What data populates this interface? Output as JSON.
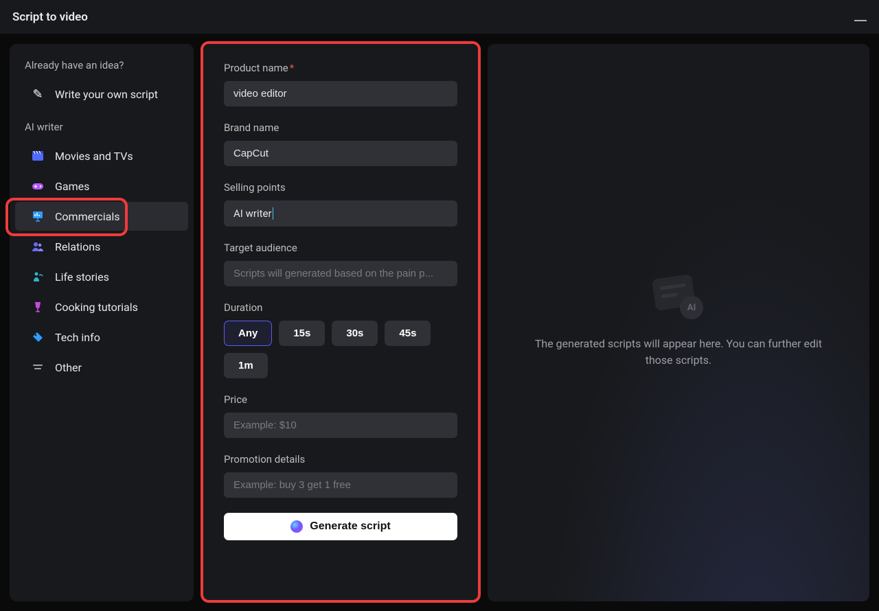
{
  "titlebar": {
    "title": "Script to video"
  },
  "sidebar": {
    "idea_label": "Already have an idea?",
    "write_own": "Write your own script",
    "ai_writer_label": "AI writer",
    "items": [
      {
        "label": "Movies and TVs",
        "name": "movies",
        "color": "#4f6bff"
      },
      {
        "label": "Games",
        "name": "games",
        "color": "#b25aff"
      },
      {
        "label": "Commercials",
        "name": "commercials",
        "color": "#2f9cff",
        "selected": true
      },
      {
        "label": "Relations",
        "name": "relations",
        "color": "#6a6bff"
      },
      {
        "label": "Life stories",
        "name": "life-stories",
        "color": "#2fb5c9"
      },
      {
        "label": "Cooking tutorials",
        "name": "cooking",
        "color": "#c64be0"
      },
      {
        "label": "Tech info",
        "name": "tech",
        "color": "#2f9cff"
      },
      {
        "label": "Other",
        "name": "other",
        "color": "#a0a0a8"
      }
    ]
  },
  "form": {
    "product_name": {
      "label": "Product name",
      "value": "video editor",
      "required": true
    },
    "brand_name": {
      "label": "Brand name",
      "value": "CapCut"
    },
    "selling_points": {
      "label": "Selling points",
      "value": "AI writer"
    },
    "target_audience": {
      "label": "Target audience",
      "placeholder": "Scripts will generated based on the pain p..."
    },
    "duration": {
      "label": "Duration",
      "options": [
        "Any",
        "15s",
        "30s",
        "45s",
        "1m"
      ],
      "selected": "Any"
    },
    "price": {
      "label": "Price",
      "placeholder": "Example: $10"
    },
    "promotion": {
      "label": "Promotion details",
      "placeholder": "Example: buy 3 get 1 free"
    },
    "generate_label": "Generate script"
  },
  "preview": {
    "ai_badge": "AI",
    "text": "The generated scripts will appear here. You can further edit those scripts."
  }
}
